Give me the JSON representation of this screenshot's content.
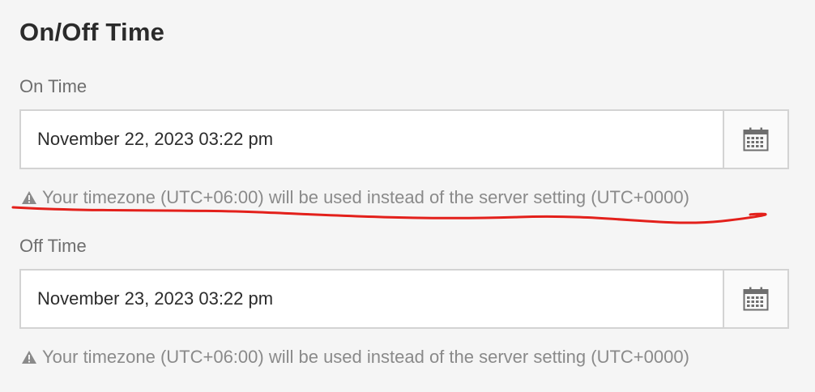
{
  "section": {
    "title": "On/Off Time"
  },
  "on_time": {
    "label": "On Time",
    "value": "November 22, 2023 03:22 pm",
    "calendar_icon": "calendar-icon",
    "help_icon": "alert-triangle-icon",
    "help_text": "Your timezone (UTC+06:00) will be used instead of the server setting (UTC+0000)"
  },
  "off_time": {
    "label": "Off Time",
    "value": "November 23, 2023 03:22 pm",
    "calendar_icon": "calendar-icon",
    "help_icon": "alert-triangle-icon",
    "help_text": "Your timezone (UTC+06:00) will be used instead of the server setting (UTC+0000)"
  },
  "annotation": {
    "color": "#e3201b"
  },
  "colors": {
    "background": "#f5f5f5",
    "border": "#d3d3d3",
    "muted_text": "#8a8a8a"
  }
}
